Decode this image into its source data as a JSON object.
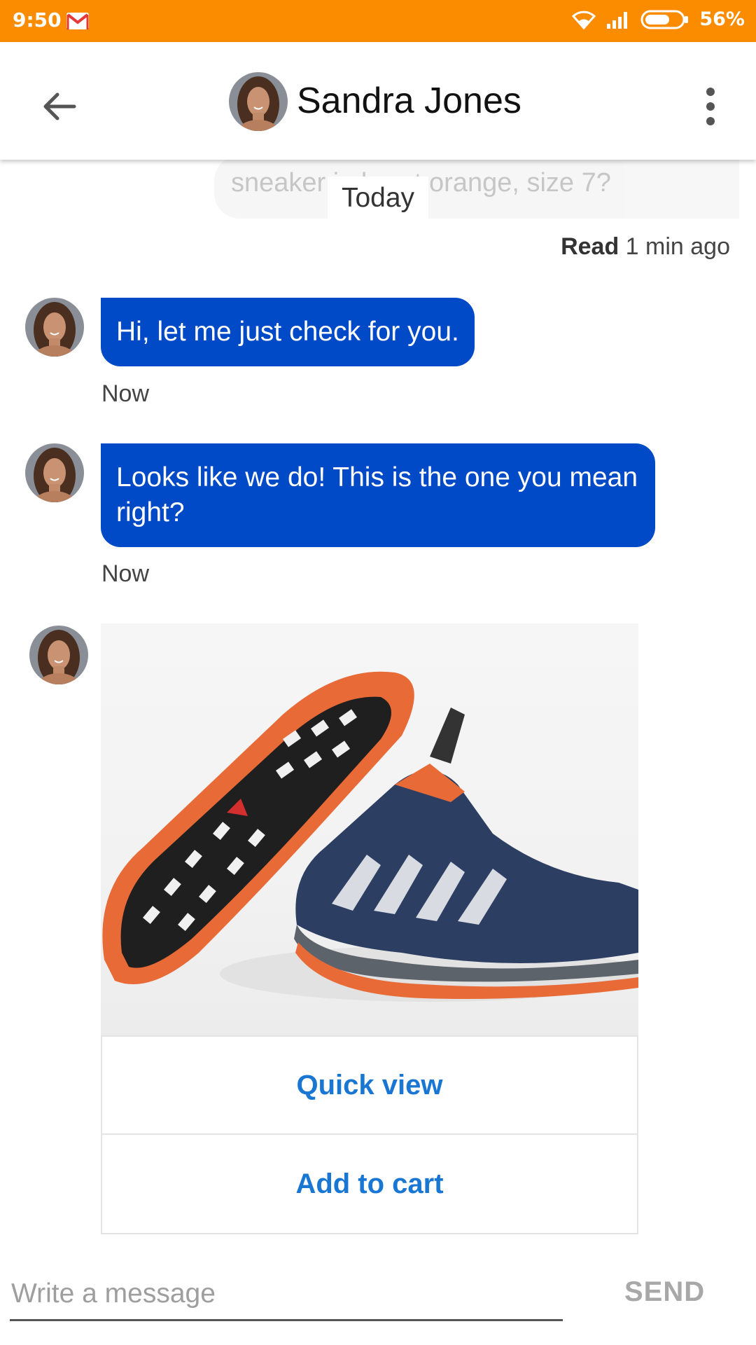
{
  "status_bar": {
    "time": "9:50",
    "battery": "56%",
    "icons": [
      "gmail-icon",
      "wifi-icon",
      "signal-icon",
      "battery-icon"
    ],
    "background": "#FB8C00"
  },
  "header": {
    "contact_name": "Sandra Jones",
    "back_icon": "arrow-back-icon",
    "menu_icon": "more-vert-icon"
  },
  "conversation": {
    "previous_message_fragment": "sneaker in burnt orange, size 7?",
    "date_divider": "Today",
    "read_receipt": {
      "label": "Read",
      "time": "1 min ago"
    },
    "messages": [
      {
        "text": "Hi, let me just check for you.",
        "time": "Now"
      },
      {
        "text": "Looks like we do! This is the one you mean right?",
        "time": "Now"
      }
    ],
    "product_card": {
      "image_alt": "Pair of navy and orange trail running sneakers",
      "actions": [
        {
          "label": "Quick view"
        },
        {
          "label": "Add to cart"
        }
      ]
    }
  },
  "composer": {
    "placeholder": "Write a message",
    "send_label": "SEND"
  },
  "colors": {
    "bubble": "#0049C7",
    "action_link": "#1976D2",
    "status_bar": "#FB8C00"
  }
}
